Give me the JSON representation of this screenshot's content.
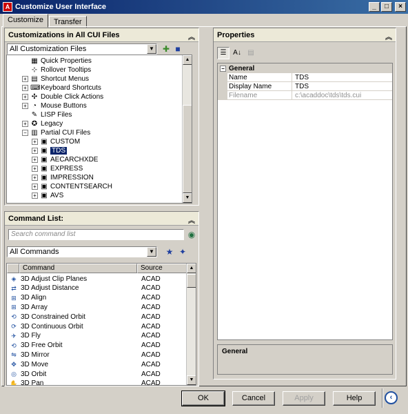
{
  "window": {
    "title": "Customize User Interface"
  },
  "tabs": [
    {
      "label": "Customize"
    },
    {
      "label": "Transfer"
    }
  ],
  "customizations": {
    "header": "Customizations in All CUI Files",
    "filter_value": "All Customization Files",
    "tree": [
      {
        "label": "Quick Properties",
        "icon": "quick-properties-icon",
        "expandable": false
      },
      {
        "label": "Rollover Tooltips",
        "icon": "rollover-tooltips-icon",
        "expandable": false
      },
      {
        "label": "Shortcut Menus",
        "icon": "shortcut-menus-icon",
        "expandable": true
      },
      {
        "label": "Keyboard Shortcuts",
        "icon": "keyboard-shortcuts-icon",
        "expandable": true
      },
      {
        "label": "Double Click Actions",
        "icon": "double-click-icon",
        "expandable": true
      },
      {
        "label": "Mouse Buttons",
        "icon": "mouse-buttons-icon",
        "expandable": true
      },
      {
        "label": "LISP Files",
        "icon": "lisp-files-icon",
        "expandable": false
      },
      {
        "label": "Legacy",
        "icon": "legacy-icon",
        "expandable": true
      },
      {
        "label": "Partial CUI Files",
        "icon": "partial-cui-icon",
        "expandable": true,
        "expanded": true
      },
      {
        "label": "CUSTOM",
        "icon": "cui-file-icon",
        "expandable": true,
        "child": true
      },
      {
        "label": "TDS",
        "icon": "cui-file-icon",
        "expandable": true,
        "child": true,
        "selected": true
      },
      {
        "label": "AECARCHXDE",
        "icon": "cui-file-icon",
        "expandable": true,
        "child": true
      },
      {
        "label": "EXPRESS",
        "icon": "cui-file-icon",
        "expandable": true,
        "child": true
      },
      {
        "label": "IMPRESSION",
        "icon": "cui-file-icon",
        "expandable": true,
        "child": true
      },
      {
        "label": "CONTENTSEARCH",
        "icon": "cui-file-icon",
        "expandable": true,
        "child": true
      },
      {
        "label": "AVS",
        "icon": "cui-file-icon",
        "expandable": true,
        "child": true
      }
    ]
  },
  "command_list": {
    "header": "Command List:",
    "search_placeholder": "Search command list",
    "filter_value": "All Commands",
    "columns": {
      "command": "Command",
      "source": "Source"
    },
    "rows": [
      {
        "name": "3D Adjust Clip Planes",
        "source": "ACAD"
      },
      {
        "name": "3D Adjust Distance",
        "source": "ACAD"
      },
      {
        "name": "3D Align",
        "source": "ACAD"
      },
      {
        "name": "3D Array",
        "source": "ACAD"
      },
      {
        "name": "3D Constrained Orbit",
        "source": "ACAD"
      },
      {
        "name": "3D Continuous Orbit",
        "source": "ACAD"
      },
      {
        "name": "3D Fly",
        "source": "ACAD"
      },
      {
        "name": "3D Free Orbit",
        "source": "ACAD"
      },
      {
        "name": "3D Mirror",
        "source": "ACAD"
      },
      {
        "name": "3D Move",
        "source": "ACAD"
      },
      {
        "name": "3D Orbit",
        "source": "ACAD"
      },
      {
        "name": "3D Pan",
        "source": "ACAD"
      }
    ]
  },
  "properties": {
    "header": "Properties",
    "category": "General",
    "rows": [
      {
        "key": "Name",
        "value": "TDS",
        "disabled": false
      },
      {
        "key": "Display Name",
        "value": "TDS",
        "disabled": false
      },
      {
        "key": "Filename",
        "value": "c:\\acaddoc\\tds\\tds.cui",
        "disabled": true
      }
    ],
    "description_title": "General"
  },
  "buttons": {
    "ok": "OK",
    "cancel": "Cancel",
    "apply": "Apply",
    "help": "Help"
  }
}
